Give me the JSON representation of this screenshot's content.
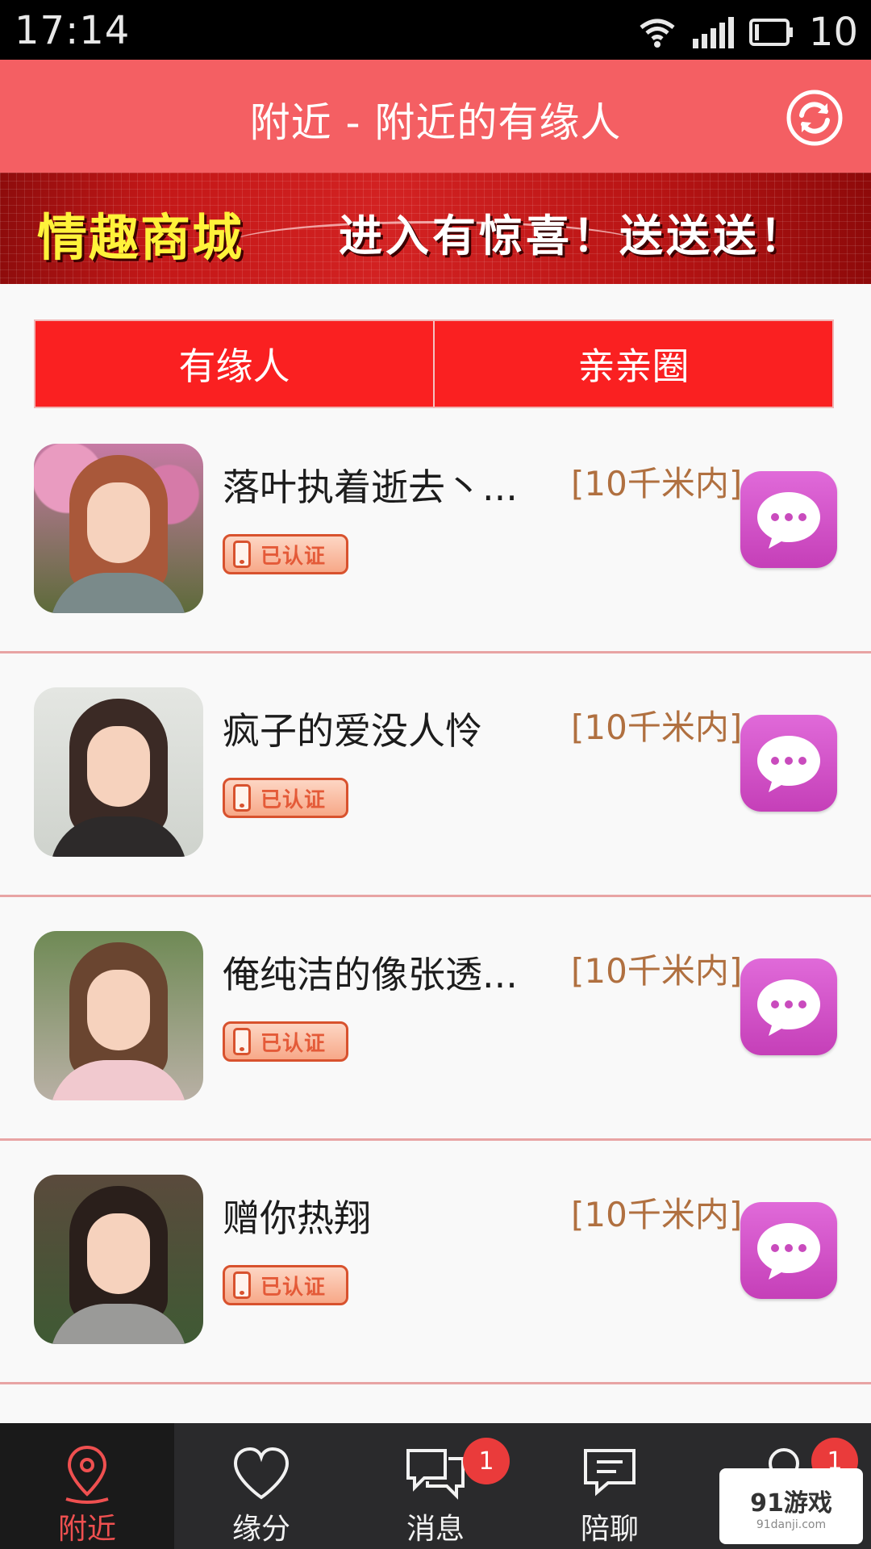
{
  "status_bar": {
    "time": "17:14",
    "battery": "10"
  },
  "header": {
    "title": "附近 - 附近的有缘人",
    "refresh_icon": "refresh-icon"
  },
  "banner": {
    "left_text": "情趣商城",
    "right_text": "进入有惊喜！送送送！"
  },
  "tabs": [
    {
      "label": "有缘人",
      "active": true
    },
    {
      "label": "亲亲圈",
      "active": false
    }
  ],
  "users": [
    {
      "name": "落叶执着逝去丶...",
      "distance": "[10千米内]",
      "verified": "已认证"
    },
    {
      "name": "疯子的爱没人怜",
      "distance": "[10千米内]",
      "verified": "已认证"
    },
    {
      "name": "俺纯洁的像张透...",
      "distance": "[10千米内]",
      "verified": "已认证"
    },
    {
      "name": "赠你热翔",
      "distance": "[10千米内]",
      "verified": "已认证"
    }
  ],
  "bottom_nav": [
    {
      "label": "附近",
      "icon": "location-pin-icon",
      "active": true,
      "badge": ""
    },
    {
      "label": "缘分",
      "icon": "heart-icon",
      "active": false,
      "badge": ""
    },
    {
      "label": "消息",
      "icon": "message-bubbles-icon",
      "active": false,
      "badge": "1"
    },
    {
      "label": "陪聊",
      "icon": "chat-lines-icon",
      "active": false,
      "badge": ""
    },
    {
      "label": "",
      "icon": "user-icon",
      "active": false,
      "badge": "1"
    }
  ],
  "watermark": {
    "main": "91游戏",
    "sub": "91danji.com"
  },
  "colors": {
    "header": "#f45f63",
    "tab_bg": "#fa2021",
    "active_nav": "#ef5050",
    "chat_button": "#d152c6",
    "divider": "#e8a4a4"
  }
}
